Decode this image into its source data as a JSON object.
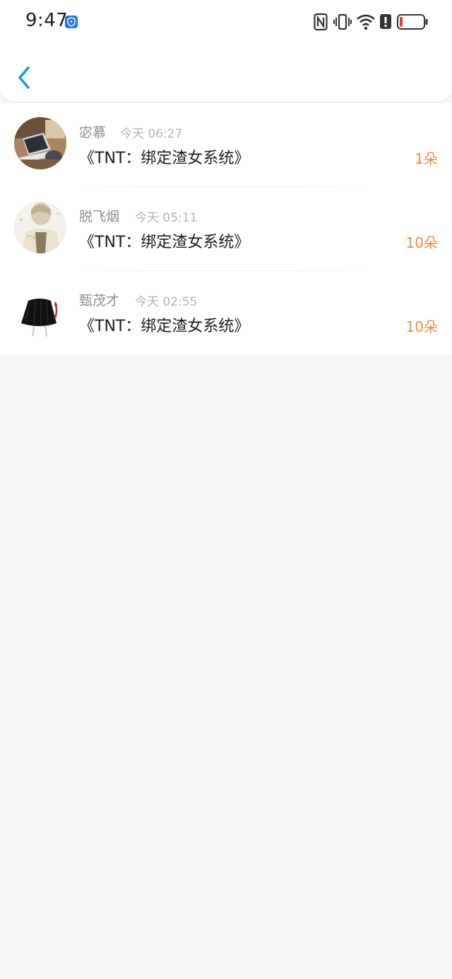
{
  "status_bar": {
    "time": "9:47",
    "icons": [
      "shield-icon",
      "nfc-icon",
      "vibrate-icon",
      "wifi-icon",
      "alert-icon",
      "battery-icon"
    ],
    "battery_color": "#e53935"
  },
  "header": {
    "back_icon": "chevron-left-icon",
    "accent_color": "#1a9be8"
  },
  "records": [
    {
      "name": "宓慕",
      "time": "今天 06:27",
      "title": "《TNT：绑定渣女系统》",
      "count": "1朵"
    },
    {
      "name": "脱飞烟",
      "time": "今天 05:11",
      "title": "《TNT：绑定渣女系统》",
      "count": "10朵"
    },
    {
      "name": "甄茂才",
      "time": "今天 02:55",
      "title": "《TNT：绑定渣女系统》",
      "count": "10朵"
    }
  ],
  "colors": {
    "count": "#ef8b3f",
    "name": "#8f8f8f",
    "time": "#b4b4b4",
    "title": "#1c1c1c",
    "background": "#f8f6f7"
  }
}
